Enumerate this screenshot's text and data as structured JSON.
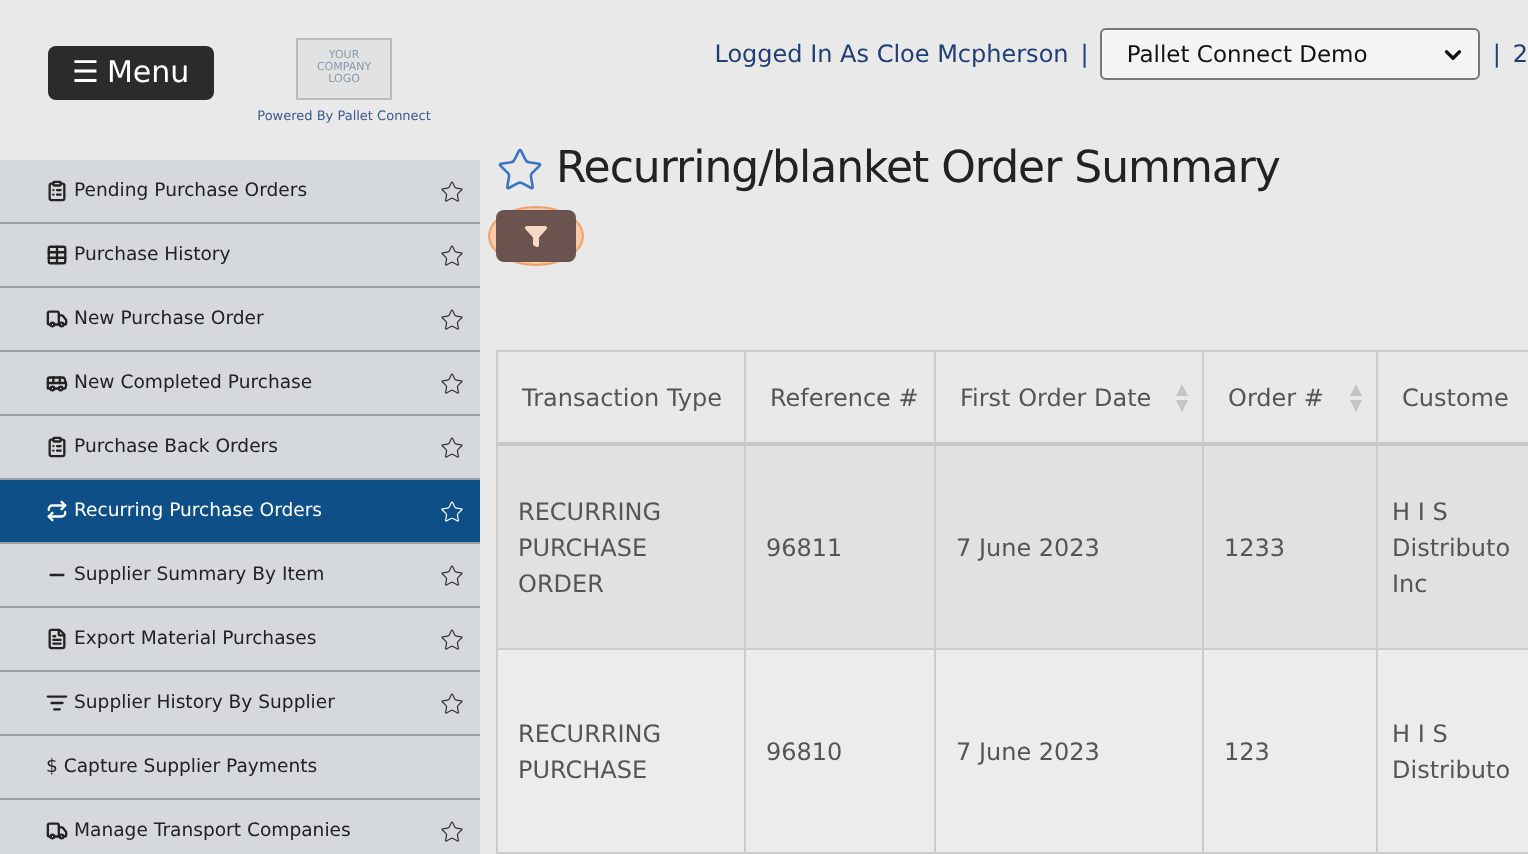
{
  "header": {
    "menu_icon": "☰",
    "menu_button": "Menu",
    "logo_lines": [
      "YOUR",
      "COMPANY",
      "LOGO"
    ],
    "powered_by": "Powered By Pallet Connect",
    "user_text": "Logged In As Cloe Mcpherson",
    "separator": "|",
    "company_select": "Pallet Connect Demo",
    "separator_2": "|",
    "trailing": "2"
  },
  "sidebar": {
    "items": [
      {
        "label": "Pending Purchase Orders",
        "selected": false,
        "favorite": false
      },
      {
        "label": "Purchase History",
        "selected": false,
        "favorite": false
      },
      {
        "label": "New Purchase Order",
        "selected": false,
        "favorite": false
      },
      {
        "label": "New Completed Purchase",
        "selected": false,
        "favorite": false
      },
      {
        "label": "Purchase Back Orders",
        "selected": false,
        "favorite": false
      },
      {
        "label": "Recurring Purchase Orders",
        "selected": true,
        "favorite": false
      },
      {
        "label": "Supplier Summary By Item",
        "selected": false,
        "favorite": false
      },
      {
        "label": "Export Material Purchases",
        "selected": false,
        "favorite": false
      },
      {
        "label": "Supplier History By Supplier",
        "selected": false,
        "favorite": false
      },
      {
        "label": "$ Capture Supplier Payments",
        "selected": false
      },
      {
        "label": "Manage Transport Companies",
        "selected": false,
        "favorite": false
      }
    ]
  },
  "page": {
    "title": "Recurring/blanket Order Summary",
    "favorite": false
  },
  "table": {
    "columns": [
      {
        "label": "Transaction Type",
        "sortable": false
      },
      {
        "label": "Reference #",
        "sortable": false
      },
      {
        "label": "First Order Date",
        "sortable": true
      },
      {
        "label": "Order #",
        "sortable": true
      },
      {
        "label": "Custome"
      }
    ],
    "rows": [
      [
        "RECURRING PURCHASE ORDER",
        "96811",
        "7 June 2023",
        "1233",
        "H I S Distributo Inc"
      ],
      [
        "RECURRING PURCHASE",
        "96810",
        "7 June 2023",
        "123",
        "H I S Distributo"
      ]
    ]
  }
}
